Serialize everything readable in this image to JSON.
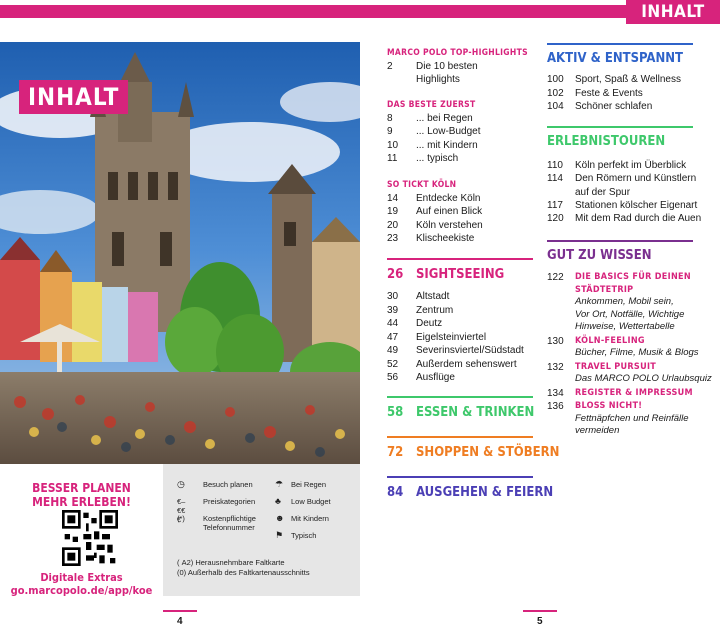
{
  "header": {
    "tab_label": "INHALT"
  },
  "left_page": {
    "badge": "INHALT",
    "promo": {
      "line1": "BESSER PLANEN",
      "line2": "MEHR ERLEBEN!",
      "extras": "Digitale Extras",
      "url": "go.marcopolo.de/app/koe"
    },
    "legend": {
      "items": [
        {
          "icon": "clock-icon",
          "glyph": "◷",
          "text": "Besuch planen"
        },
        {
          "icon": "euro-icon",
          "glyph": "€–€€€",
          "text": "Preiskategorien"
        },
        {
          "icon": "asterisk-icon",
          "glyph": "(*)",
          "text": "Kostenpflichtige",
          "text2": "Telefonnummer"
        },
        {
          "icon": "umbrella-icon",
          "glyph": "☂",
          "text": "Bei Regen"
        },
        {
          "icon": "piggy-bank-icon",
          "glyph": "♣",
          "text": "Low Budget"
        },
        {
          "icon": "family-icon",
          "glyph": "☻",
          "text": "Mit Kindern"
        },
        {
          "icon": "flag-icon",
          "glyph": "⚑",
          "text": "Typisch"
        }
      ],
      "map_note1": "( A2) Herausnehmbare Faltkarte",
      "map_note2": "(0) Außerhalb des Faltkartenausschnitts"
    },
    "page_number": "4"
  },
  "right_page": {
    "page_number": "5",
    "col1": {
      "top_highlights": {
        "title": "MARCO POLO TOP-HIGHLIGHTS",
        "rows": [
          {
            "n": "2",
            "l": "Die 10 besten",
            "l2": "Highlights"
          }
        ]
      },
      "das_beste": {
        "title": "DAS BESTE ZUERST",
        "rows": [
          {
            "n": "8",
            "l": "... bei Regen"
          },
          {
            "n": "9",
            "l": "... Low-Budget"
          },
          {
            "n": "10",
            "l": "... mit Kindern"
          },
          {
            "n": "11",
            "l": "... typisch"
          }
        ]
      },
      "so_tickt": {
        "title": "SO TICKT KÖLN",
        "rows": [
          {
            "n": "14",
            "l": "Entdecke Köln"
          },
          {
            "n": "19",
            "l": "Auf einen Blick"
          },
          {
            "n": "20",
            "l": "Köln verstehen"
          },
          {
            "n": "23",
            "l": "Klischeekiste"
          }
        ]
      },
      "sightseeing": {
        "n": "26",
        "title": "SIGHTSEEING",
        "color": "#d7237c",
        "rows": [
          {
            "n": "30",
            "l": "Altstadt"
          },
          {
            "n": "39",
            "l": "Zentrum"
          },
          {
            "n": "44",
            "l": "Deutz"
          },
          {
            "n": "47",
            "l": "Eigelsteinviertel"
          },
          {
            "n": "49",
            "l": "Severinsviertel/Südstadt"
          },
          {
            "n": "52",
            "l": "Außerdem sehenswert"
          },
          {
            "n": "56",
            "l": "Ausflüge"
          }
        ]
      },
      "essen": {
        "n": "58",
        "title": "ESSEN & TRINKEN",
        "color": "#3ec86b"
      },
      "shoppen": {
        "n": "72",
        "title": "SHOPPEN & STÖBERN",
        "color": "#ef7d22"
      },
      "ausgehen": {
        "n": "84",
        "title": "AUSGEHEN & FEIERN",
        "color": "#4b3fb5"
      }
    },
    "col2": {
      "aktiv": {
        "title": "AKTIV & ENTSPANNT",
        "color": "#2f63c9",
        "rows": [
          {
            "n": "100",
            "l": "Sport, Spaß & Wellness"
          },
          {
            "n": "102",
            "l": "Feste & Events"
          },
          {
            "n": "104",
            "l": "Schöner schlafen"
          }
        ]
      },
      "erlebnis": {
        "title": "ERLEBNISTOUREN",
        "color": "#3ec86b",
        "rows": [
          {
            "n": "110",
            "l": "Köln perfekt im Überblick"
          },
          {
            "n": "114",
            "l": "Den Römern und Künstlern",
            "l2": "auf der Spur"
          },
          {
            "n": "117",
            "l": "Stationen kölscher Eigenart"
          },
          {
            "n": "120",
            "l": "Mit dem Rad durch die Auen"
          }
        ]
      },
      "gut_zu_wissen": {
        "title": "GUT ZU WISSEN",
        "color": "#7a2f8f",
        "entries": [
          {
            "n": "122",
            "title": "DIE BASICS FÜR DEINEN",
            "title2": "STÄDTETRIP",
            "desc": [
              "Ankommen, Mobil sein,",
              "Vor Ort, Notfälle, Wichtige",
              "Hinweise, Wettertabelle"
            ]
          },
          {
            "n": "130",
            "title": "KÖLN-FEELING",
            "desc": [
              "Bücher, Filme, Musik & Blogs"
            ]
          },
          {
            "n": "132",
            "title": "TRAVEL PURSUIT",
            "desc": [
              "Das MARCO POLO Urlaubsquiz"
            ]
          },
          {
            "n": "134",
            "title": "REGISTER & IMPRESSUM",
            "desc": []
          },
          {
            "n": "136",
            "title": "BLOSS NICHT!",
            "desc": [
              "Fettnäpfchen und Reinfälle",
              "vermeiden"
            ]
          }
        ]
      }
    }
  },
  "colors": {
    "magenta": "#d7237c",
    "green": "#3ec86b",
    "orange": "#ef7d22",
    "indigo": "#4b3fb5",
    "blue": "#2f63c9",
    "purple": "#7a2f8f"
  }
}
